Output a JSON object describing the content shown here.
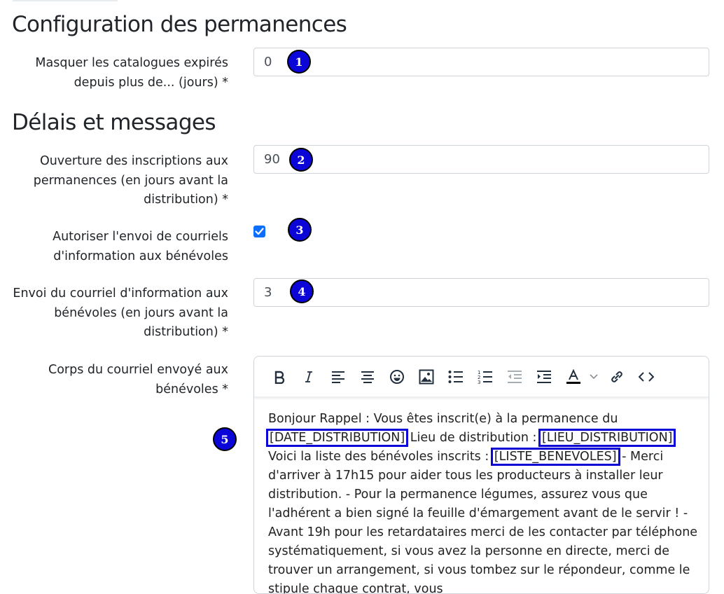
{
  "sections": {
    "config_title": "Configuration des permanences",
    "delais_title": "Délais et messages"
  },
  "fields": {
    "masquer": {
      "label_l1": "Masquer les catalogues expirés",
      "label_l2": "depuis plus de... (jours) *",
      "value": "0"
    },
    "ouverture": {
      "label_l1": "Ouverture des inscriptions aux",
      "label_l2": "permanences (en jours avant la",
      "label_l3": "distribution) *",
      "value": "90"
    },
    "autoriser": {
      "label_l1": "Autoriser l'envoi de courriels",
      "label_l2": "d'information aux bénévoles",
      "checked": true
    },
    "envoi": {
      "label_l1": "Envoi du courriel d'information aux",
      "label_l2": "bénévoles (en jours avant la",
      "label_l3": "distribution) *",
      "value": "3"
    },
    "corps": {
      "label_l1": "Corps du courriel envoyé aux",
      "label_l2": "bénévoles *"
    }
  },
  "badges": [
    "1",
    "2",
    "3",
    "4",
    "5"
  ],
  "editor": {
    "toolbar": [
      "bold-icon",
      "italic-icon",
      "align-left-icon",
      "align-center-icon",
      "emoji-icon",
      "image-icon",
      "bullet-list-icon",
      "numbered-list-icon",
      "outdent-icon",
      "indent-icon",
      "text-color-icon",
      "chevron-down-icon",
      "link-icon",
      "code-icon"
    ],
    "text_1": "Bonjour Rappel : Vous êtes inscrit(e) à la permanence du",
    "tag_date": "[DATE_DISTRIBUTION]",
    "text_2": " Lieu de distribution : ",
    "tag_lieu": "[LIEU_DISTRIBUTION]",
    "text_3": " Voici la liste des bénévoles inscrits : ",
    "tag_liste": "[LISTE_BENEVOLES]",
    "text_4": " - Merci d'arriver à 17h15 pour aider tous les producteurs à installer leur distribution. - Pour la permanence légumes, assurez vous que l'adhérent a bien signé la feuille d'émargement avant de le servir ! - Avant 19h pour les retardataires merci de les contacter par téléphone systématiquement, si vous avez la personne en directe, merci de trouver un arrangement, si vous tombez sur le répondeur, comme le stipule chaque contrat, vous"
  },
  "colors": {
    "badge": "#0b05d8",
    "checkbox": "#0d6efd"
  }
}
